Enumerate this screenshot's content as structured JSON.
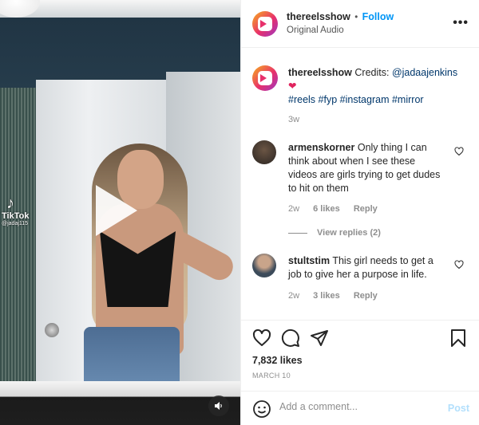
{
  "video": {
    "watermark": {
      "brand": "TikTok",
      "handle": "@jadaj115"
    },
    "icons": {
      "play": "play-icon",
      "sound": "speaker-icon",
      "tiktok": "tiktok-logo-icon"
    }
  },
  "header": {
    "username": "thereelsshow",
    "separator": "•",
    "follow_label": "Follow",
    "audio": "Original Audio",
    "more": "•••"
  },
  "caption": {
    "username": "thereelsshow",
    "text": "Credits:",
    "mention": "@jadaajenkins",
    "emoji": "❤️",
    "hashtags": [
      "#reels",
      "#fyp",
      "#instagram",
      "#mirror"
    ],
    "age": "3w"
  },
  "comments": [
    {
      "username": "armenskorner",
      "text": "Only thing I can think about when I see these videos are girls trying to get dudes to hit on them",
      "age": "2w",
      "likes": "6 likes",
      "reply": "Reply",
      "view_replies": "View replies (2)"
    },
    {
      "username": "stultstim",
      "text": "This girl needs to get a job to give her a purpose in life.",
      "age": "2w",
      "likes": "3 likes",
      "reply": "Reply"
    }
  ],
  "actions": {
    "likes": "7,832 likes",
    "date": "MARCH 10"
  },
  "add_comment": {
    "placeholder": "Add a comment...",
    "post_label": "Post"
  },
  "colors": {
    "link_blue": "#0095f6",
    "hashtag_blue": "#00376b",
    "post_disabled": "#b2dffc",
    "muted": "#8e8e8e"
  }
}
